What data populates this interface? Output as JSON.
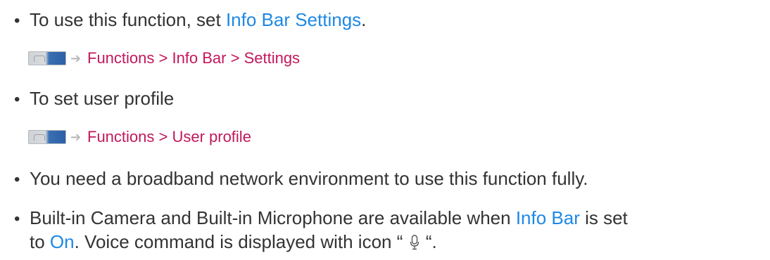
{
  "bullets": {
    "b1": {
      "prefix": "To use this function, set ",
      "link": "Info Bar Settings",
      "suffix": "."
    },
    "p1": {
      "path": "Functions > Info Bar > Settings"
    },
    "b2": {
      "text": "To set user profile"
    },
    "p2": {
      "path": "Functions > User profile"
    },
    "b3": {
      "text": "You need a broadband network environment to use this function fully."
    },
    "b4": {
      "prefix": "Built-in Camera and Built-in Microphone are available when ",
      "link1": "Info Bar",
      "mid": " is set",
      "line2_prefix": "to ",
      "link2": "On",
      "line2_mid": ". Voice command is displayed with icon “ ",
      "line2_suffix": " “."
    }
  },
  "icons": {
    "menu": "tv-menu-icon",
    "arrow": "right-arrow-icon",
    "mic": "microphone-icon"
  },
  "colors": {
    "text": "#333333",
    "link": "#1e88e5",
    "path": "#c2185b"
  }
}
